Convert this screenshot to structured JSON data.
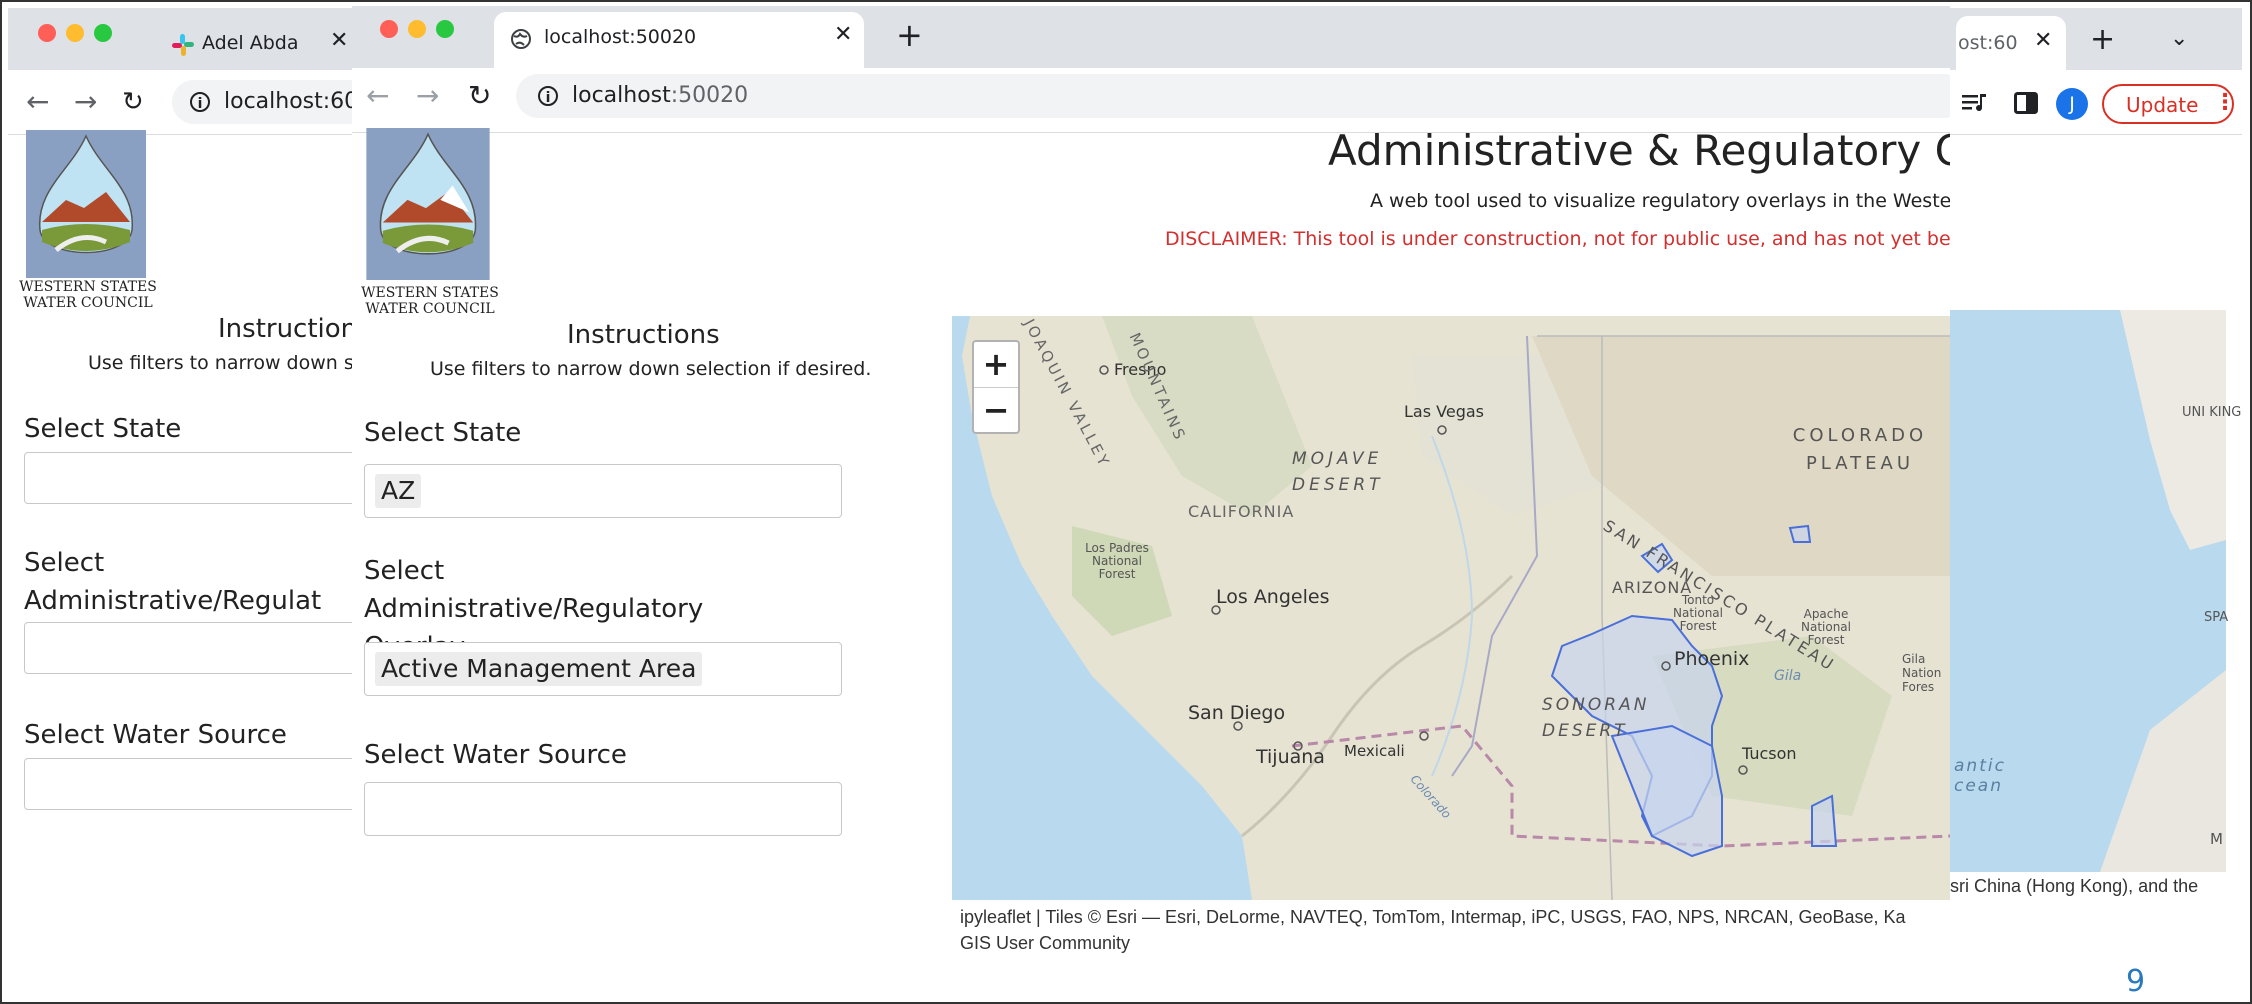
{
  "back_window": {
    "tab_title": "Adel Abdallah",
    "url": "localhost:60",
    "right_tab_title": "ost:60",
    "update_label": "Update",
    "avatar_letter": "J"
  },
  "front_window": {
    "tab_title": "localhost:50020",
    "url_host": "localhost",
    "url_port": ":50020"
  },
  "app": {
    "title": "Administrative & Regulatory Overla",
    "subtitle": "A web tool used to visualize regulatory overlays in the Western Ur",
    "disclaimer": "DISCLAIMER: This tool is under construction, not for public use, and has not yet been full",
    "logo_line1": "WESTERN STATES",
    "logo_line2": "WATER COUNCIL",
    "instructions_heading": "Instructions",
    "instructions_text": "Use filters to narrow down selection if desired.",
    "state_label": "Select State",
    "state_value": "AZ",
    "overlay_label": "Select Administrative/Regulatory Overlay",
    "overlay_value": "Active Management Area",
    "source_label": "Select Water Source",
    "source_value": ""
  },
  "back_app": {
    "instructions_heading": "Instructions",
    "instructions_text": "Use filters to narrow down sele",
    "state_label": "Select State",
    "overlay_label": "Select Administrative/Regulat Overlay",
    "source_label": "Select Water Source"
  },
  "map": {
    "zoom_in": "+",
    "zoom_out": "−",
    "labels": {
      "fresno": "Fresno",
      "las_vegas": "Las Vegas",
      "colorado_plateau": "COLORADO PLATEAU",
      "mojave": "MOJAVE DESERT",
      "california": "CALIFORNIA",
      "los_padres": "Los Padres National Forest",
      "los_angeles": "Los Angeles",
      "sf_plateau": "SAN FRANCISCO PLATEAU",
      "arizona": "ARIZONA",
      "tonto": "Tonto National Forest",
      "apache": "Apache National Forest",
      "phoenix": "Phoenix",
      "gila": "Gila",
      "san_diego": "San Diego",
      "sonoran": "SONORAN DESERT",
      "tijuana": "Tijuana",
      "mexicali": "Mexicali",
      "tucson": "Tucson",
      "colorado_river": "Colorado",
      "san_joaquin": "JOAQUIN VALLEY",
      "mountains": "MOUNTAINS",
      "gila_nation": "Gila Nation Fores",
      "atlantic": "antic cean",
      "uni": "UNI KING",
      "spa": "SPA",
      "m": "M"
    },
    "attribution_line1": "ipyleaflet | Tiles © Esri — Esri, DeLorme, NAVTEQ, TomTom, Intermap, iPC, USGS, FAO, NPS, NRCAN, GeoBase, Ka",
    "attribution_line2": "GIS User Community",
    "attribution_back": "sri China (Hong Kong), and the"
  },
  "slide": {
    "page_number": "9"
  },
  "colors": {
    "overlay_fill": "#c8d4ee",
    "overlay_stroke": "#4a6fd8",
    "disclaimer": "#d32f2f",
    "page_number": "#2a7bbd"
  }
}
